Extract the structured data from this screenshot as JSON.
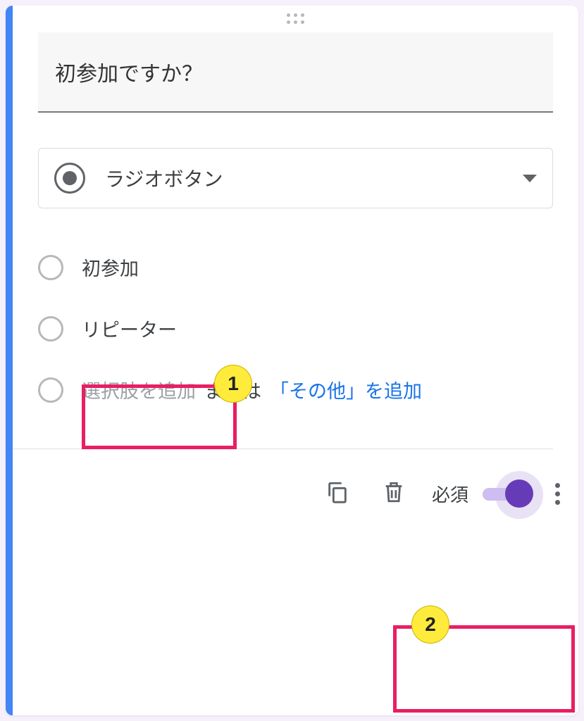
{
  "question": {
    "title": "初参加ですか？"
  },
  "type": {
    "label": "ラジオボタン"
  },
  "options": [
    {
      "label": "初参加"
    },
    {
      "label": "リピーター"
    }
  ],
  "add": {
    "placeholder": "選択肢を追加",
    "or": "または",
    "other": "「その他」を追加"
  },
  "footer": {
    "required_label": "必須"
  },
  "annotations": {
    "badge1": "1",
    "badge2": "2"
  }
}
